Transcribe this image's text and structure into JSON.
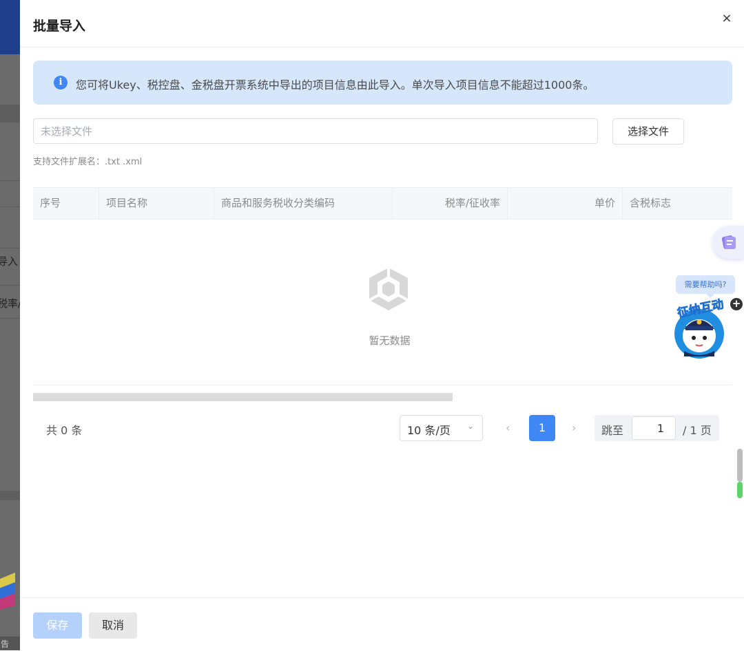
{
  "background": {
    "partial_texts": [
      "导入",
      "税率/"
    ],
    "footer_text": "告"
  },
  "drawer": {
    "title": "批量导入",
    "close_label": "×"
  },
  "notice": {
    "icon": "info-icon",
    "icon_glyph": "i",
    "text": "您可将Ukey、税控盘、金税盘开票系统中导出的项目信息由此导入。单次导入项目信息不能超过1000条。"
  },
  "file": {
    "value": "",
    "placeholder": "未选择文件",
    "choose_label": "选择文件",
    "hint": "支持文件扩展名：.txt .xml"
  },
  "table": {
    "columns": [
      "序号",
      "项目名称",
      "商品和服务税收分类编码",
      "税率/征收率",
      "单价",
      "含税标志"
    ],
    "rows": [],
    "empty_text": "暂无数据"
  },
  "pagination": {
    "total": "共 0 条",
    "page_size": "10 条/页",
    "current_page": "1",
    "jump_label": "跳至",
    "jump_value": "1",
    "total_pages": "/ 1 页"
  },
  "helper": {
    "bubble": "需要帮助吗?",
    "badge": "征纳互动",
    "plus": "+"
  },
  "footer": {
    "save_label": "保存",
    "cancel_label": "取消"
  },
  "colors": {
    "primary": "#3f87f5",
    "notice_bg": "#d6e7fb",
    "disabled_primary": "#b3d1fb"
  }
}
